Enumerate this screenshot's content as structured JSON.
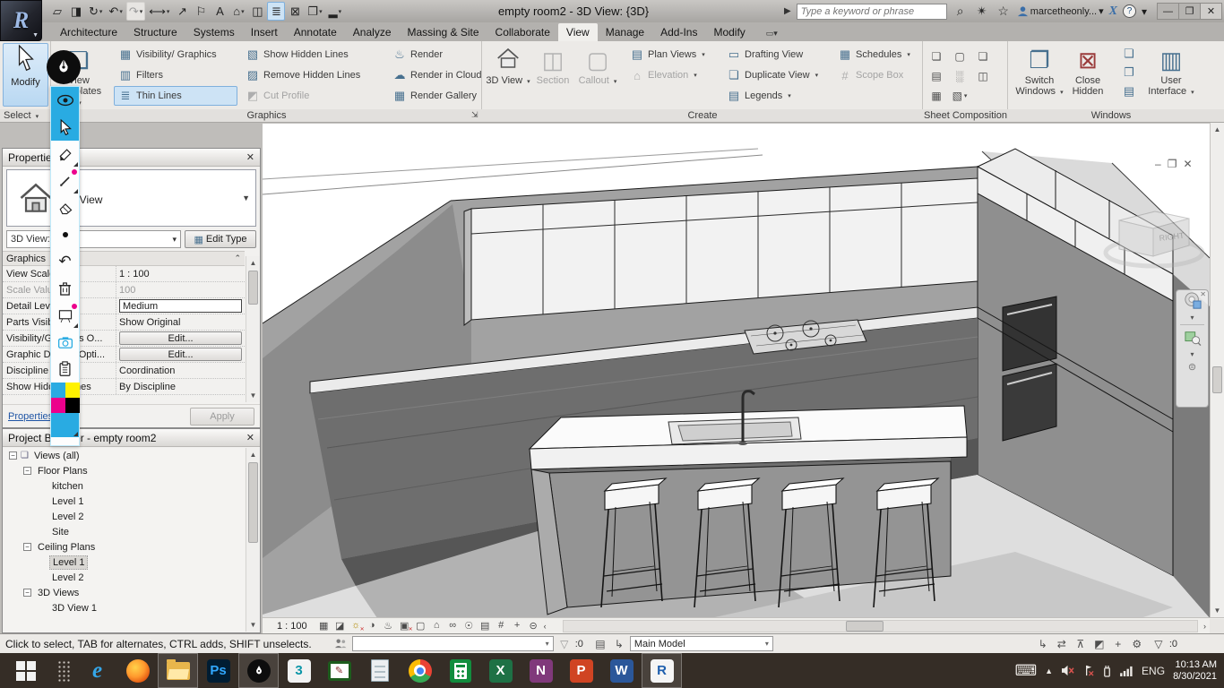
{
  "window": {
    "title": "empty room2 - 3D View: {3D}",
    "search_placeholder": "Type a keyword or phrase",
    "account_name": "marcetheonly...",
    "qat": [
      {
        "name": "open"
      },
      {
        "name": "save"
      },
      {
        "name": "sync",
        "arrow": true
      },
      {
        "name": "undo",
        "arrow": true
      },
      {
        "name": "redo",
        "arrow": true,
        "disabled": true
      },
      {
        "name": "measure",
        "arrow": true
      },
      {
        "name": "aligned-dimension"
      },
      {
        "name": "tag"
      },
      {
        "name": "text"
      },
      {
        "name": "default-3d-view",
        "arrow": true
      },
      {
        "name": "section"
      },
      {
        "name": "thin-lines",
        "active": true
      },
      {
        "name": "close-hidden-windows"
      },
      {
        "name": "switch-windows",
        "arrow": true
      },
      {
        "name": "customize-qat",
        "arrow": true
      }
    ]
  },
  "ribbon": {
    "tabs": [
      {
        "label": "Architecture"
      },
      {
        "label": "Structure"
      },
      {
        "label": "Systems"
      },
      {
        "label": "Insert"
      },
      {
        "label": "Annotate"
      },
      {
        "label": "Analyze"
      },
      {
        "label": "Massing & Site"
      },
      {
        "label": "Collaborate"
      },
      {
        "label": "View",
        "active": true
      },
      {
        "label": "Manage"
      },
      {
        "label": "Add-Ins"
      },
      {
        "label": "Modify"
      }
    ],
    "select_panel": {
      "modify": "Modify",
      "select": "Select"
    },
    "graphics": {
      "label": "Graphics",
      "big": {
        "label": "View Templates",
        "icon": "view-templates",
        "arrow": true
      },
      "col1": [
        {
          "label": "Visibility/ Graphics",
          "icon": "visibility-graphics"
        },
        {
          "label": "Filters",
          "icon": "filters"
        },
        {
          "label": "Thin Lines",
          "icon": "thin-lines",
          "highlight": true
        }
      ],
      "col2": [
        {
          "label": "Show Hidden Lines",
          "icon": "show-hidden"
        },
        {
          "label": "Remove Hidden Lines",
          "icon": "remove-hidden"
        },
        {
          "label": "Cut Profile",
          "icon": "cut-profile",
          "disabled": true
        }
      ],
      "col3": [
        {
          "label": "Render",
          "icon": "render"
        },
        {
          "label": "Render in Cloud",
          "icon": "render-cloud"
        },
        {
          "label": "Render Gallery",
          "icon": "render-gallery"
        }
      ]
    },
    "create": {
      "label": "Create",
      "bigs": [
        {
          "label": "3D View",
          "icon": "house",
          "arrow": true
        },
        {
          "label": "Section",
          "icon": "section",
          "disabled": true
        },
        {
          "label": "Callout",
          "icon": "callout",
          "disabled": true,
          "arrow": true
        }
      ],
      "col1": [
        {
          "label": "Plan Views",
          "icon": "plan-views",
          "arrow": true
        },
        {
          "label": "Elevation",
          "icon": "elevation",
          "arrow": true,
          "disabled": true
        }
      ],
      "col2": [
        {
          "label": "Drafting View",
          "icon": "drafting-view"
        },
        {
          "label": "Duplicate View",
          "icon": "duplicate-view",
          "arrow": true
        },
        {
          "label": "Legends",
          "icon": "legends",
          "arrow": true
        }
      ],
      "col3": [
        {
          "label": "Schedules",
          "icon": "schedules",
          "arrow": true
        },
        {
          "label": "Scope Box",
          "icon": "scope-box",
          "disabled": true
        }
      ]
    },
    "sheet": {
      "label": "Sheet Composition",
      "icons": [
        "new-sheet",
        "title-block",
        "revisions",
        "sheet-list",
        "guide-grid",
        "matchline",
        "viewports",
        "view-reference"
      ]
    },
    "windows": {
      "label": "Windows",
      "bigs": [
        {
          "label": "Switch Windows",
          "icon": "switch-windows",
          "arrow": true
        },
        {
          "label": "Close Hidden",
          "icon": "close-hidden"
        }
      ],
      "smalls": [
        "new-window",
        "cascade-windows",
        "tile-windows"
      ],
      "user": {
        "label": "User Interface",
        "icon": "user-interface",
        "arrow": true
      }
    }
  },
  "properties": {
    "title": "Properties",
    "type_name": "3D View",
    "instance_label": "3D View:",
    "edit_type_label": "Edit Type",
    "section_label": "Graphics",
    "rows": [
      {
        "label": "View Scale",
        "value": "1 : 100",
        "kind": "text"
      },
      {
        "label": "Scale Value    1:",
        "value": "100",
        "kind": "disabled"
      },
      {
        "label": "Detail Level",
        "value": "Medium",
        "kind": "editing"
      },
      {
        "label": "Parts Visibility",
        "value": "Show Original",
        "kind": "text"
      },
      {
        "label": "Visibility/Graphics O...",
        "value": "Edit...",
        "kind": "button"
      },
      {
        "label": "Graphic Display Opti...",
        "value": "Edit...",
        "kind": "button"
      },
      {
        "label": "Discipline",
        "value": "Coordination",
        "kind": "text"
      },
      {
        "label": "Show Hidden Lines",
        "value": "By Discipline",
        "kind": "text"
      }
    ],
    "link_label": "Properties",
    "apply_label": "Apply"
  },
  "browser": {
    "title": "Project Browser - empty room2",
    "items": [
      {
        "label": "Views (all)",
        "depth": 0,
        "expander": true,
        "icon": true
      },
      {
        "label": "Floor Plans",
        "depth": 1,
        "expander": true
      },
      {
        "label": "kitchen",
        "depth": 2
      },
      {
        "label": "Level 1",
        "depth": 2
      },
      {
        "label": "Level 2",
        "depth": 2
      },
      {
        "label": "Site",
        "depth": 2
      },
      {
        "label": "Ceiling Plans",
        "depth": 1,
        "expander": true
      },
      {
        "label": "Level 1",
        "depth": 2,
        "selected": true
      },
      {
        "label": "Level 2",
        "depth": 2
      },
      {
        "label": "3D Views",
        "depth": 1,
        "expander": true
      },
      {
        "label": "3D View 1",
        "depth": 2
      }
    ]
  },
  "viewport": {
    "scale": "1 : 100",
    "viewcube_face": "RIGHT",
    "vcb_icons": [
      {
        "name": "detail-level"
      },
      {
        "name": "visual-style"
      },
      {
        "name": "sun-path",
        "badge": "#c33"
      },
      {
        "name": "shadows"
      },
      {
        "name": "rendering-dialog"
      },
      {
        "name": "crop-view",
        "badge": "#c33"
      },
      {
        "name": "crop-region"
      },
      {
        "name": "locked-3d"
      },
      {
        "name": "temporary-hide-isolate"
      },
      {
        "name": "reveal-hidden"
      },
      {
        "name": "temporary-view-properties"
      },
      {
        "name": "analytical-model"
      },
      {
        "name": "displacement-sets"
      },
      {
        "name": "reveal-constraints"
      }
    ]
  },
  "statusbar": {
    "hint": "Click to select, TAB for alternates, CTRL adds, SHIFT unselects.",
    "workset_value": "",
    "workset_count": ":0",
    "design_option": "Main Model",
    "selection_icons": [
      "select-links",
      "select-underlay",
      "select-pinned",
      "select-by-face",
      "drag-on-selection",
      "press-drag"
    ],
    "filter_count": ":0"
  },
  "taskbar": {
    "apps": [
      {
        "name": "start",
        "kind": "start"
      },
      {
        "name": "grip",
        "kind": "grip"
      },
      {
        "name": "internet-explorer",
        "kind": "ie"
      },
      {
        "name": "firefox",
        "kind": "firefox"
      },
      {
        "name": "file-explorer",
        "kind": "explorer",
        "open": true
      },
      {
        "name": "photoshop",
        "kind": "letter",
        "label": "Ps",
        "bg": "#001d33",
        "fg": "#31a8ff"
      },
      {
        "name": "epic-pen",
        "kind": "epicpen",
        "open": true
      },
      {
        "name": "3ds-max",
        "kind": "letter",
        "label": "3",
        "bg": "#f2f2f2",
        "fg": "#0b96a8"
      },
      {
        "name": "green-sketchpad",
        "kind": "greenpad"
      },
      {
        "name": "notepad",
        "kind": "notepad"
      },
      {
        "name": "chrome",
        "kind": "chrome"
      },
      {
        "name": "calculator",
        "kind": "calc"
      },
      {
        "name": "excel",
        "kind": "letter",
        "label": "X",
        "bg": "#1e7145",
        "fg": "#ffffff"
      },
      {
        "name": "onenote",
        "kind": "letter",
        "label": "N",
        "bg": "#80397b",
        "fg": "#ffffff"
      },
      {
        "name": "powerpoint",
        "kind": "letter",
        "label": "P",
        "bg": "#d04423",
        "fg": "#ffffff"
      },
      {
        "name": "word",
        "kind": "letter",
        "label": "W",
        "bg": "#2b579a",
        "fg": "#ffffff"
      },
      {
        "name": "revit",
        "kind": "letter",
        "label": "R",
        "bg": "#f5f5f5",
        "fg": "#1f5fae",
        "open": true
      }
    ],
    "tray": {
      "lang": "ENG",
      "time": "10:13 AM",
      "date": "8/30/2021"
    }
  },
  "epic_pen": {
    "tools": [
      {
        "name": "eye",
        "active": true
      },
      {
        "name": "cursor",
        "active": true
      },
      {
        "name": "highlighter",
        "corner": true
      },
      {
        "name": "pen",
        "dot": "#ec008c",
        "corner": true
      },
      {
        "name": "eraser"
      },
      {
        "name": "size-dot"
      },
      {
        "name": "undo"
      },
      {
        "name": "trash"
      },
      {
        "name": "whiteboard",
        "dot": "#ec008c",
        "corner": true
      },
      {
        "name": "screenshot"
      },
      {
        "name": "clipboard"
      }
    ],
    "palette": [
      "#29abe2",
      "#fff200",
      "#ec008c",
      "#000000"
    ],
    "active_color": "#29abe2"
  }
}
